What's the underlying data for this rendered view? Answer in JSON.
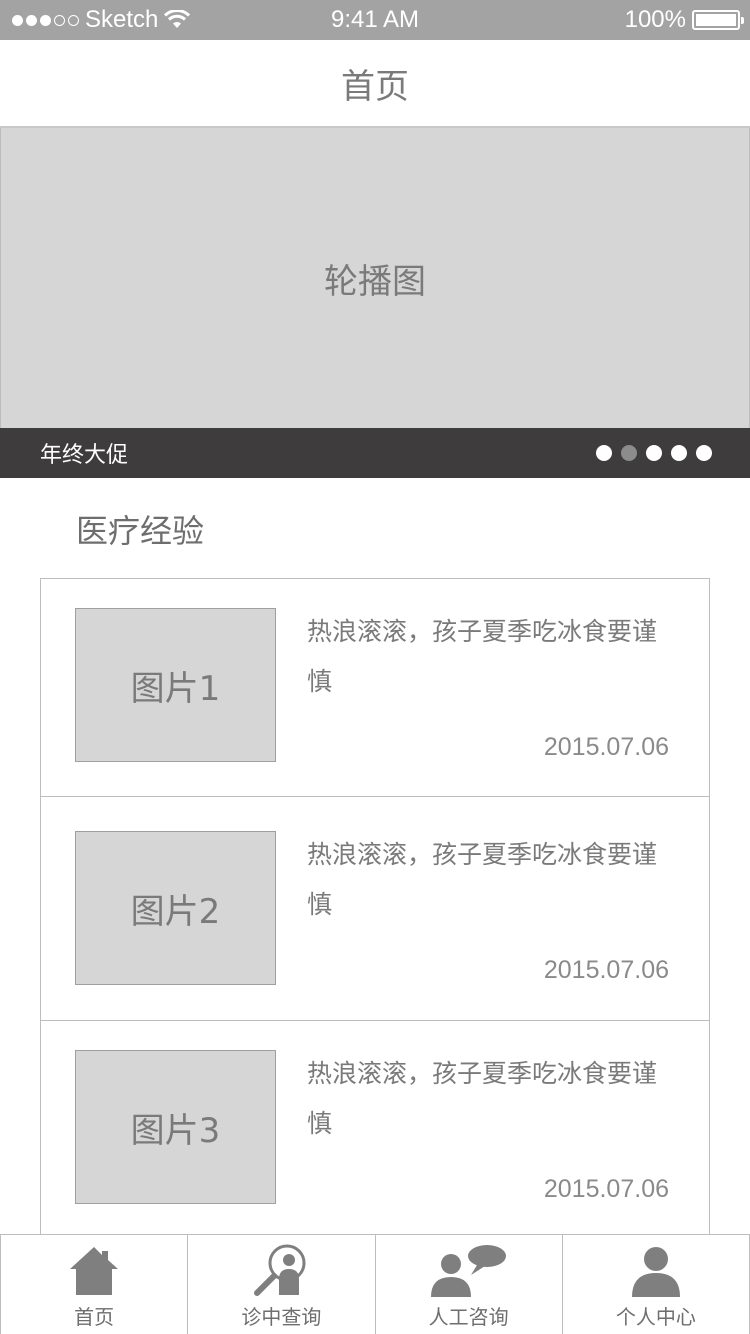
{
  "status_bar": {
    "carrier": "Sketch",
    "time": "9:41 AM",
    "battery": "100%",
    "signal_icon": "signal-dots-icon",
    "wifi_icon": "wifi-icon",
    "battery_icon": "battery-icon"
  },
  "nav": {
    "title": "首页"
  },
  "carousel": {
    "label": "轮播图",
    "caption": "年终大促",
    "page_count": 5,
    "active_page": 2
  },
  "section": {
    "title": "医疗经验"
  },
  "articles": [
    {
      "image_label": "图片1",
      "title": "热浪滚滚，孩子夏季吃冰食要谨慎",
      "date": "2015.07.06"
    },
    {
      "image_label": "图片2",
      "title": "热浪滚滚，孩子夏季吃冰食要谨慎",
      "date": "2015.07.06"
    },
    {
      "image_label": "图片3",
      "title": "热浪滚滚，孩子夏季吃冰食要谨慎",
      "date": "2015.07.06"
    }
  ],
  "tabs": [
    {
      "label": "首页",
      "icon": "home-icon"
    },
    {
      "label": "诊中查询",
      "icon": "search-person-icon"
    },
    {
      "label": "人工咨询",
      "icon": "chat-people-icon"
    },
    {
      "label": "个人中心",
      "icon": "user-icon"
    }
  ],
  "colors": {
    "status_bar": "#a3a3a3",
    "caption_bar": "#3e3c3c",
    "placeholder": "#d6d6d6",
    "text": "#7a7a7a"
  }
}
